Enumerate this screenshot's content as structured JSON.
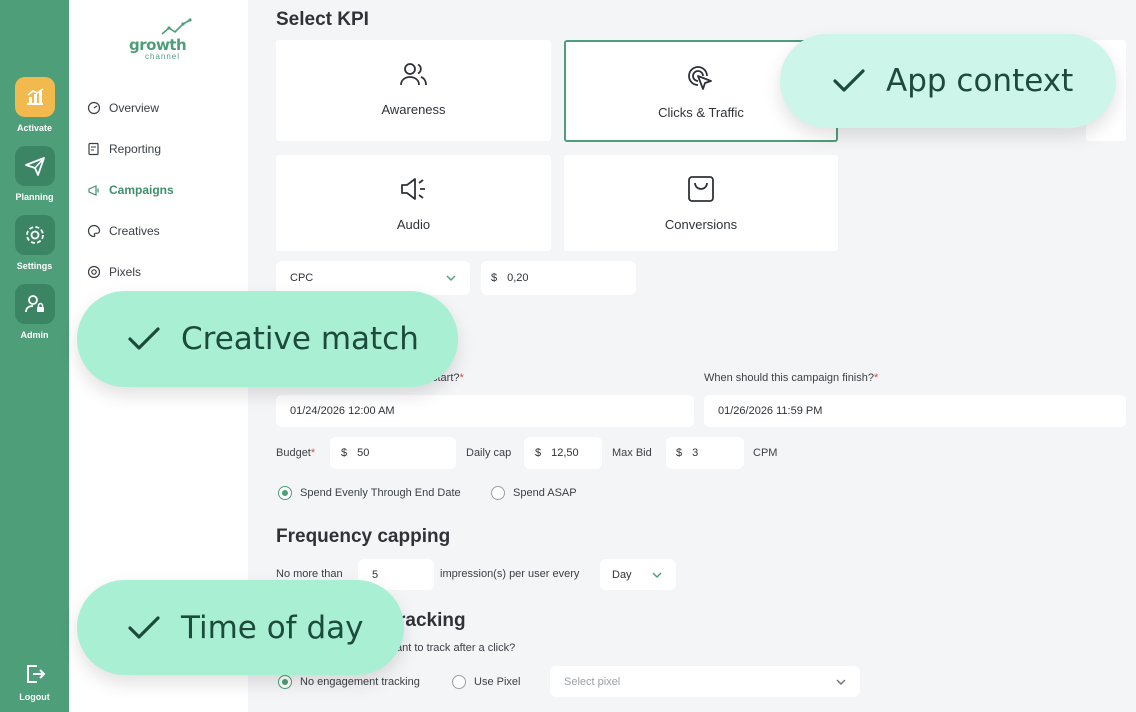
{
  "rail": {
    "items": [
      {
        "label": "Activate",
        "icon": "chart-bars-icon",
        "active": true
      },
      {
        "label": "Planning",
        "icon": "paper-plane-icon",
        "active": false
      },
      {
        "label": "Settings",
        "icon": "gear-icon",
        "active": false
      },
      {
        "label": "Admin",
        "icon": "user-lock-icon",
        "active": false
      }
    ],
    "logout_label": "Logout"
  },
  "logo": {
    "word": "growth",
    "sub": "channel"
  },
  "sidenav": {
    "items": [
      {
        "label": "Overview",
        "icon": "gauge-icon"
      },
      {
        "label": "Reporting",
        "icon": "report-icon"
      },
      {
        "label": "Campaigns",
        "icon": "megaphone-icon",
        "active": true
      },
      {
        "label": "Creatives",
        "icon": "palette-icon"
      },
      {
        "label": "Pixels",
        "icon": "target-icon"
      }
    ]
  },
  "kpi": {
    "heading": "Select KPI",
    "options": [
      {
        "label": "Awareness",
        "icon": "users-icon"
      },
      {
        "label": "Clicks & Traffic",
        "icon": "cursor-click-icon",
        "selected": true
      },
      {
        "label": "Audio",
        "icon": "speaker-icon"
      },
      {
        "label": "Conversions",
        "icon": "bag-icon"
      }
    ],
    "pricing_model": "CPC",
    "currency": "$",
    "price": "0,20"
  },
  "schedule": {
    "start_question": "start?",
    "finish_question": "When should this campaign finish?",
    "required_mark": "*",
    "start_value": "01/24/2026 12:00 AM",
    "end_value": "01/26/2026 11:59 PM"
  },
  "budget": {
    "budget_label": "Budget",
    "required_mark": "*",
    "currency": "$",
    "budget_value": "50",
    "daily_cap_label": "Daily cap",
    "daily_cap_value": "12,50",
    "max_bid_label": "Max Bid",
    "max_bid_value": "3",
    "unit": "CPM",
    "pacing_even": "Spend Evenly Through End Date",
    "pacing_asap": "Spend ASAP",
    "pacing_selected": "even"
  },
  "frequency": {
    "heading": "Frequency capping",
    "prefix": "No more than",
    "value": "5",
    "suffix": "impression(s) per user every",
    "period": "Day"
  },
  "tracking": {
    "heading_fragment": "racking",
    "question_fragment": "ant to track after a click?",
    "option_none": "No engagement tracking",
    "option_pixel": "Use Pixel",
    "pixel_placeholder": "Select pixel"
  },
  "overlays": {
    "app_context": "App context",
    "creative_match": "Creative match",
    "time_of_day": "Time of day"
  },
  "colors": {
    "brand_green": "#4e9e7a",
    "rail_icon_bg": "#3b8564",
    "active_orange": "#f2b94f",
    "pill_mint": "#cdf5ea",
    "pill_green": "#a8efd4",
    "pill_text": "#1d4b3b"
  }
}
